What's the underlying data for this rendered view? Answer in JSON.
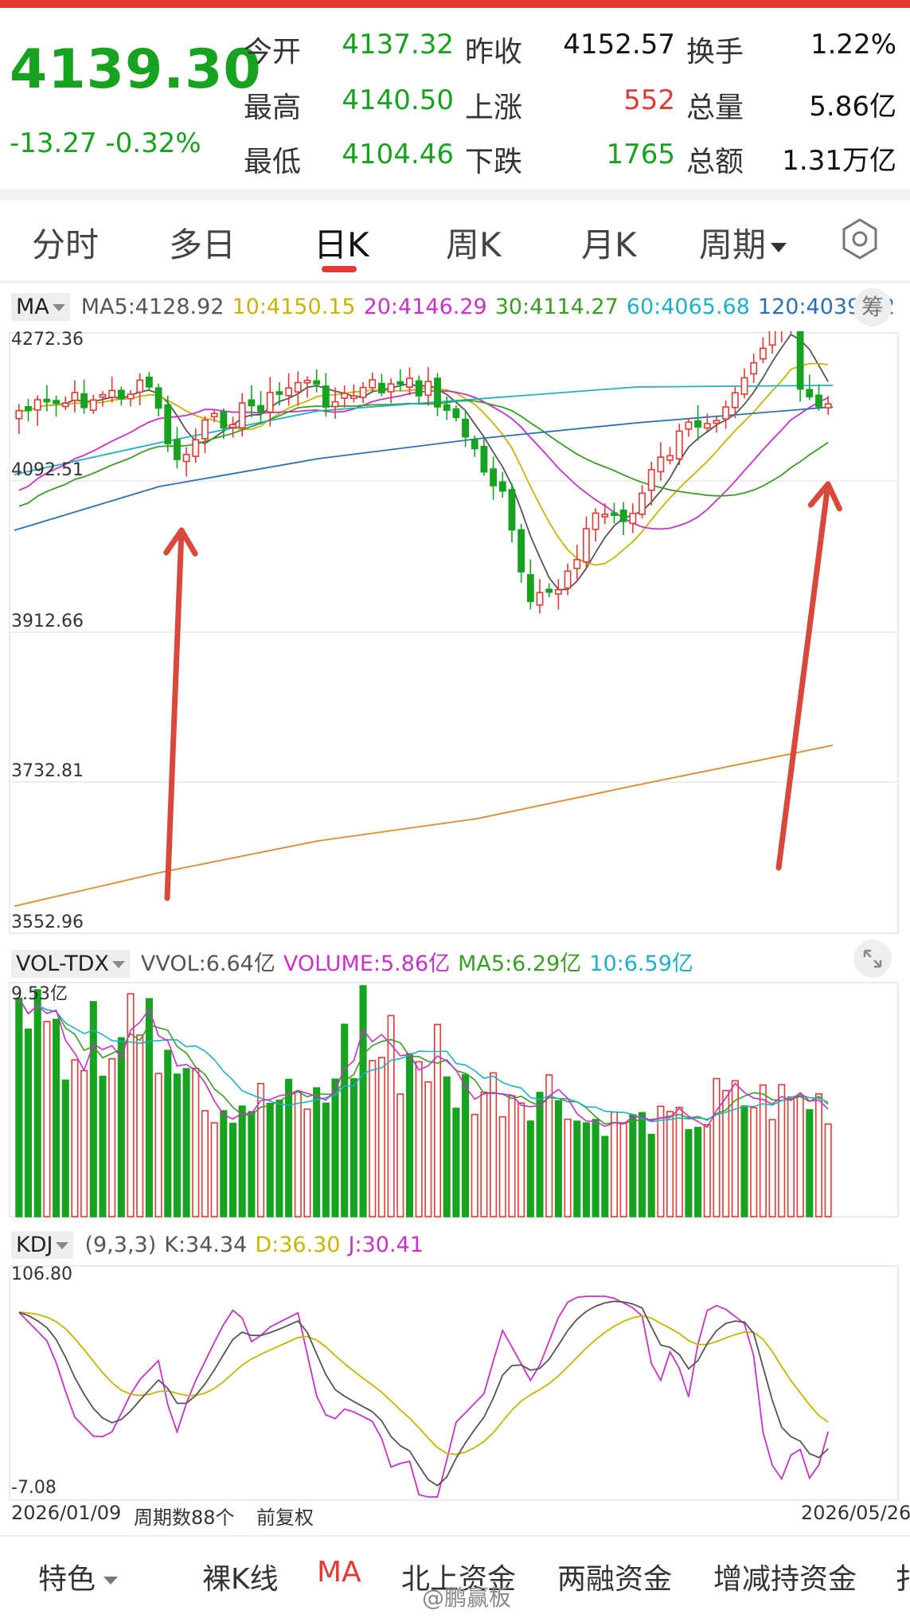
{
  "quote": {
    "price": "4139.30",
    "change": "-13.27",
    "change_pct": "-0.32%",
    "rows": [
      [
        {
          "label": "今开",
          "value": "4137.32",
          "color": "#17a21f"
        },
        {
          "label": "昨收",
          "value": "4152.57",
          "color": "#111111"
        },
        {
          "label": "换手",
          "value": "1.22%",
          "color": "#111111"
        }
      ],
      [
        {
          "label": "最高",
          "value": "4140.50",
          "color": "#17a21f"
        },
        {
          "label": "上涨",
          "value": "552",
          "color": "#e53935"
        },
        {
          "label": "总量",
          "value": "5.86亿",
          "color": "#111111"
        }
      ],
      [
        {
          "label": "最低",
          "value": "4104.46",
          "color": "#17a21f"
        },
        {
          "label": "下跌",
          "value": "1765",
          "color": "#17a21f"
        },
        {
          "label": "总额",
          "value": "1.31万亿",
          "color": "#111111"
        }
      ]
    ]
  },
  "tabs": [
    "分时",
    "多日",
    "日K",
    "周K",
    "月K",
    "周期"
  ],
  "active_tab": "日K",
  "ma_row": {
    "selector": "MA",
    "items": [
      {
        "text": "MA5:4128.92",
        "color": "#555555"
      },
      {
        "text": "10:4150.15",
        "color": "#c9b400"
      },
      {
        "text": "20:4146.29",
        "color": "#c931c9"
      },
      {
        "text": "30:4114.27",
        "color": "#3a9d23"
      },
      {
        "text": "60:4065.68",
        "color": "#1fb0c8"
      },
      {
        "text": "120:4039.22",
        "color": "#2b6fb6"
      }
    ],
    "chip": "筹"
  },
  "price_axis": [
    "4272.36",
    "4092.51",
    "3912.66",
    "3732.81",
    "3552.96"
  ],
  "vol_row": {
    "selector": "VOL-TDX",
    "items": [
      {
        "text": "VVOL:6.64亿",
        "color": "#555555"
      },
      {
        "text": "VOLUME:5.86亿",
        "color": "#c931c9"
      },
      {
        "text": "MA5:6.29亿",
        "color": "#3a9d23"
      },
      {
        "text": "10:6.59亿",
        "color": "#1fb0c8"
      }
    ],
    "axis_top": "9.53亿"
  },
  "kdj_row": {
    "selector": "KDJ",
    "items": [
      {
        "text": "(9,3,3)",
        "color": "#555555"
      },
      {
        "text": "K:34.34",
        "color": "#555555"
      },
      {
        "text": "D:36.30",
        "color": "#c9b400"
      },
      {
        "text": "J:30.41",
        "color": "#c931c9"
      }
    ],
    "axis_top": "106.80",
    "axis_bottom": "-7.08"
  },
  "footer_info": {
    "start_date": "2026/01/09",
    "period_count": "周期数88个",
    "adjust": "前复权",
    "end_date": "2026/05/26"
  },
  "bottom_nav": [
    "特色",
    "裸K线",
    "MA",
    "北上资金",
    "两融资金",
    "增减持资金",
    "扌"
  ],
  "bottom_nav_active": "MA",
  "watermark": "@鹏赢板",
  "colors": {
    "up": "#e53935",
    "down": "#17a21f",
    "arrow": "#d9483b"
  }
}
